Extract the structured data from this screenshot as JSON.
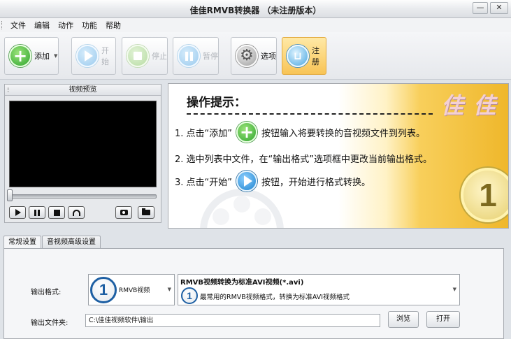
{
  "window": {
    "title": "佳佳RMVB转换器 （未注册版本）",
    "minimize_glyph": "—",
    "close_glyph": "✕"
  },
  "menu": [
    "文件",
    "编辑",
    "动作",
    "功能",
    "帮助"
  ],
  "toolbar": {
    "add": "添加",
    "start": "开始",
    "stop": "停止",
    "pause": "暂停",
    "options": "选项",
    "register": "注册"
  },
  "preview": {
    "title": "视频预览"
  },
  "tips": {
    "title": "操作提示：",
    "brand": "佳佳",
    "line1_before": "1. 点击“添加”",
    "line1_after": "按钮输入将要转换的音视频文件到列表。",
    "line2": "2. 选中列表中文件，在“输出格式”选项框中更改当前输出格式。",
    "line3_before": "3. 点击“开始”",
    "line3_after": "按钮，开始进行格式转换。",
    "step_number": "1"
  },
  "settings": {
    "tabs": [
      "常规设置",
      "音视频高级设置"
    ],
    "output_format_label": "输出格式:",
    "format_badge": "1",
    "format_value": "RMVB视频",
    "format_title": "RMVB视频转换为标准AVI视频(*.avi)",
    "format_desc_badge": "1",
    "format_desc": "最常用的RMVB视频格式，转换为标准AVI视频格式",
    "output_folder_label": "输出文件夹:",
    "output_folder_value": "C:\\佳佳视频软件\\输出",
    "browse": "浏览",
    "open": "打开"
  },
  "colors": {
    "add_green": "#2fa52f",
    "start_blue": "#1d83cf",
    "register_bg": "#f8c456",
    "badge_blue": "#1d5fa3"
  }
}
